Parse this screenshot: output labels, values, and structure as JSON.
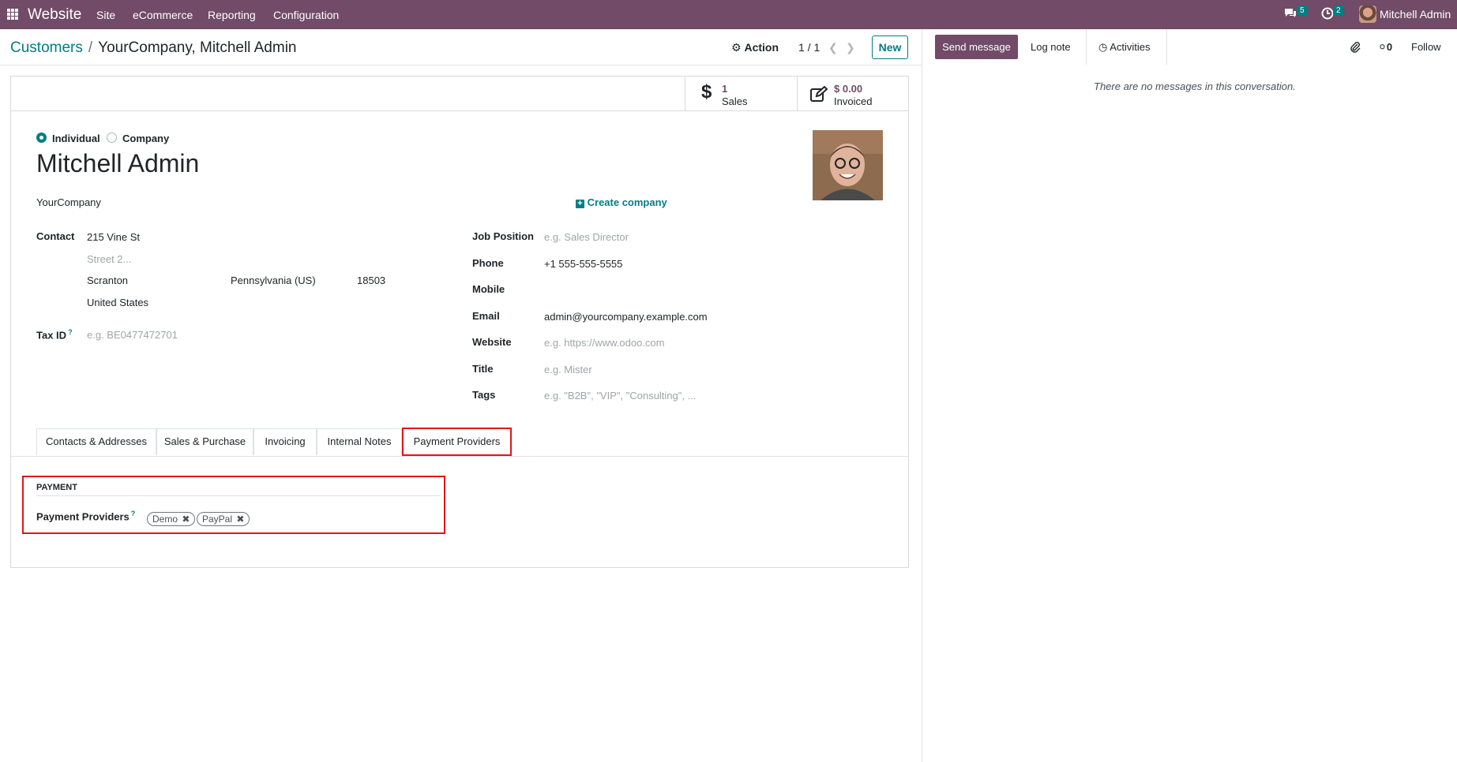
{
  "navbar": {
    "app_name": "Website",
    "menu": [
      "Site",
      "eCommerce",
      "Reporting",
      "Configuration"
    ],
    "messages_count": "5",
    "activities_count": "2",
    "user_name": "Mitchell Admin"
  },
  "breadcrumb": {
    "parent": "Customers",
    "separator": "/",
    "current": "YourCompany, Mitchell Admin"
  },
  "control_panel": {
    "action_label": "Action",
    "pager": "1 / 1",
    "new_label": "New"
  },
  "stat_buttons": [
    {
      "value": "1",
      "label": "Sales",
      "icon": "dollar-icon"
    },
    {
      "value": "$ 0.00",
      "label": "Invoiced",
      "icon": "pencil-square-icon"
    }
  ],
  "form": {
    "type_individual": "Individual",
    "type_company": "Company",
    "name": "Mitchell Admin",
    "company": "YourCompany",
    "create_company": "Create company",
    "contact_label": "Contact",
    "street": "215 Vine St",
    "street2_placeholder": "Street 2...",
    "city": "Scranton",
    "state": "Pennsylvania (US)",
    "zip": "18503",
    "country": "United States",
    "tax_id_label": "Tax ID",
    "tax_id_placeholder": "e.g. BE0477472701",
    "help_mark": "?",
    "job_position_label": "Job Position",
    "job_position_placeholder": "e.g. Sales Director",
    "phone_label": "Phone",
    "phone": "+1 555-555-5555",
    "mobile_label": "Mobile",
    "email_label": "Email",
    "email": "admin@yourcompany.example.com",
    "website_label": "Website",
    "website_placeholder": "e.g. https://www.odoo.com",
    "title_label": "Title",
    "title_placeholder": "e.g. Mister",
    "tags_label": "Tags",
    "tags_placeholder": "e.g. \"B2B\", \"VIP\", \"Consulting\", ..."
  },
  "tabs": [
    "Contacts & Addresses",
    "Sales & Purchase",
    "Invoicing",
    "Internal Notes",
    "Payment Providers"
  ],
  "active_tab": "Payment Providers",
  "payment": {
    "section_title": "PAYMENT",
    "providers_label": "Payment Providers",
    "providers": [
      "Demo",
      "PayPal"
    ]
  },
  "chatter": {
    "send_message": "Send message",
    "log_note": "Log note",
    "activities": "Activities",
    "followers_count": "0",
    "follow": "Follow",
    "empty_text": "There are no messages in this conversation."
  },
  "colors": {
    "brand": "#714b67",
    "accent": "#017e84",
    "highlight": "#e0161a"
  }
}
